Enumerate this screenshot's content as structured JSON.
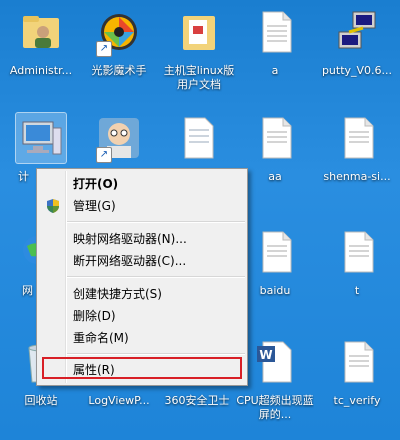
{
  "desktop": {
    "icons": [
      {
        "label": "Administr..."
      },
      {
        "label": "光影魔术手"
      },
      {
        "label": "主机宝linux版用户文档"
      },
      {
        "label": "a"
      },
      {
        "label": "putty_V0.6..."
      },
      {
        "label": "计"
      },
      {
        "label": ""
      },
      {
        "label": ""
      },
      {
        "label": "aa"
      },
      {
        "label": "shenma-si..."
      },
      {
        "label": "网"
      },
      {
        "label": "baidu"
      },
      {
        "label": "t"
      },
      {
        "label": "回收站"
      },
      {
        "label": "LogViewP..."
      },
      {
        "label": "360安全卫士"
      },
      {
        "label": "CPU超频出现蓝屏的..."
      },
      {
        "label": "tc_verify"
      }
    ]
  },
  "context_menu": {
    "items": [
      {
        "label": "打开(O)"
      },
      {
        "label": "管理(G)"
      },
      {
        "label": "映射网络驱动器(N)..."
      },
      {
        "label": "断开网络驱动器(C)..."
      },
      {
        "label": "创建快捷方式(S)"
      },
      {
        "label": "删除(D)"
      },
      {
        "label": "重命名(M)"
      },
      {
        "label": "属性(R)"
      }
    ]
  },
  "colors": {
    "highlight_border": "#d81f26",
    "desktop_bg": "#1e84d8"
  }
}
